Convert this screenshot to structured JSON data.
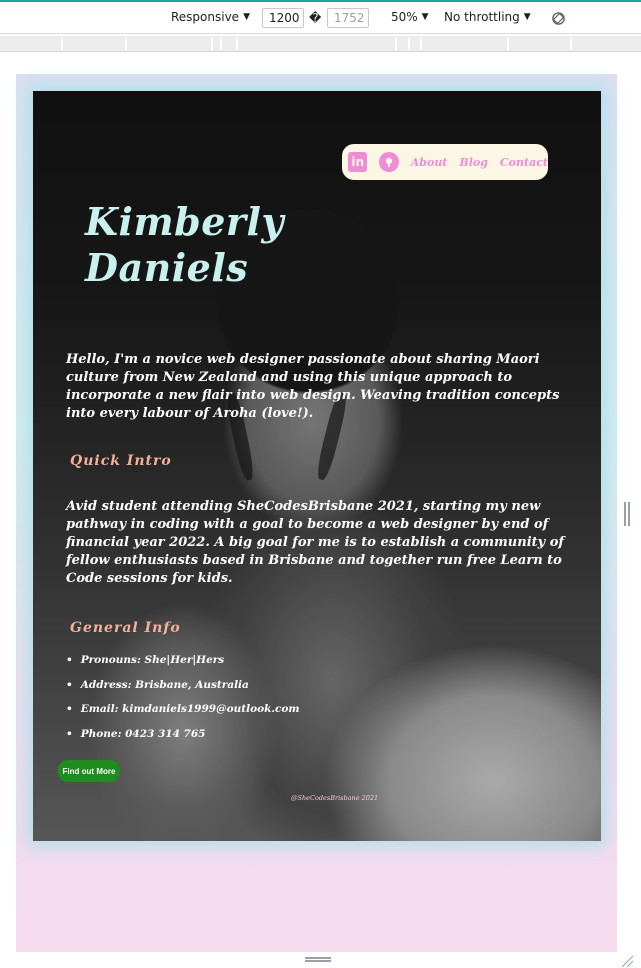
{
  "devtools": {
    "device_mode": "Responsive",
    "width_value": "1200",
    "swap_glyph": "�",
    "height_value": "1752",
    "zoom": "50%",
    "throttling": "No throttling",
    "rotate_icon": "rotate-icon"
  },
  "site": {
    "nav": {
      "linkedin_icon": "linkedin-icon",
      "github_icon": "github-icon",
      "linkedin_glyph": "in",
      "links": [
        "About",
        "Blog",
        "Contact"
      ]
    },
    "name_line1": "Kimberly",
    "name_line2": "Daniels",
    "intro": "Hello, I'm a novice web designer passionate about sharing Maori culture from New Zealand and using this unique approach to incorporate a new flair into web design. Weaving tradition concepts into every labour of Aroha (love!).",
    "quick_intro_heading": "Quick Intro",
    "quick_intro_text": "Avid student attending SheCodesBrisbane 2021, starting my new pathway in coding with a goal to become a web designer by end of financial year 2022. A big goal for me is to establish a community of fellow enthusiasts based in Brisbane and together run free Learn to Code sessions for kids.",
    "general_info_heading": "General Info",
    "general_info": [
      "Pronouns: She|Her|Hers",
      "Address: Brisbane, Australia",
      "Email: kimdaniels1999@outlook.com",
      "Phone: 0423 314 765"
    ],
    "cta_label": "Find out More",
    "credit": "@SheCodesBrisbane 2021",
    "colors": {
      "name": "#c8f0ef",
      "heading": "#f4b09a",
      "nav_accent": "#f08bd6",
      "nav_bg": "#fbf7e4",
      "button": "#1f8c1f"
    }
  }
}
